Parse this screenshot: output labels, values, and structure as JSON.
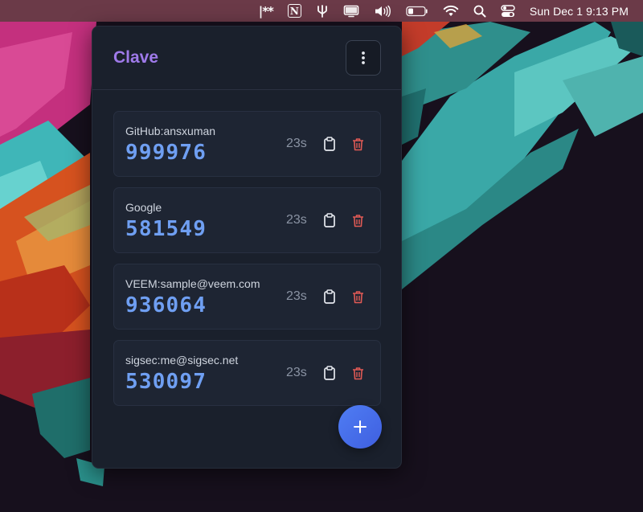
{
  "menubar": {
    "bitwarden": "|**",
    "notion": "N",
    "date_time": "Sun Dec 1  9:13 PM",
    "icons": [
      "bitwarden-icon",
      "notion-icon",
      "fork-icon",
      "display-icon",
      "volume-icon",
      "battery-icon",
      "wifi-icon",
      "search-icon",
      "control-center-icon"
    ]
  },
  "app": {
    "title": "Clave",
    "accent_color": "#9f7aea",
    "code_color": "#6f9ff2",
    "delete_color": "#e05a55"
  },
  "accounts": [
    {
      "issuer": "GitHub:ansxuman",
      "code": "999976",
      "timer": "23s"
    },
    {
      "issuer": "Google",
      "code": "581549",
      "timer": "23s"
    },
    {
      "issuer": "VEEM:sample@veem.com",
      "code": "936064",
      "timer": "23s"
    },
    {
      "issuer": "sigsec:me@sigsec.net",
      "code": "530097",
      "timer": "23s"
    }
  ],
  "actions": {
    "copy_icon": "clipboard-icon",
    "delete_icon": "trash-icon",
    "add_icon": "plus-icon",
    "menu_icon": "more-vertical-icon"
  }
}
